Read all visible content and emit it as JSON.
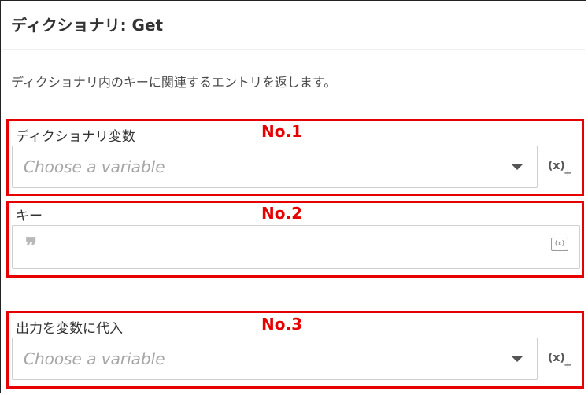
{
  "header": {
    "title": "ディクショナリ: Get",
    "description": "ディクショナリ内のキーに関連するエントリを返します。"
  },
  "fields": {
    "dictionary": {
      "label": "ディクショナリ変数",
      "placeholder": "Choose a variable",
      "annotation": "No.1",
      "var_button": "(x)",
      "var_plus": "+"
    },
    "key": {
      "label": "キー",
      "annotation": "No.2",
      "quote_icon": "❞",
      "var_mini": "(x)"
    },
    "output": {
      "label": "出力を変数に代入",
      "placeholder": "Choose a variable",
      "annotation": "No.3",
      "var_button": "(x)",
      "var_plus": "+"
    }
  },
  "colors": {
    "highlight": "#e60000",
    "text": "#333333",
    "placeholder": "#a6a6a6",
    "border": "#cfcfcf"
  },
  "icons": [
    "caret-down-icon",
    "variable-insert-icon",
    "quote-icon"
  ]
}
